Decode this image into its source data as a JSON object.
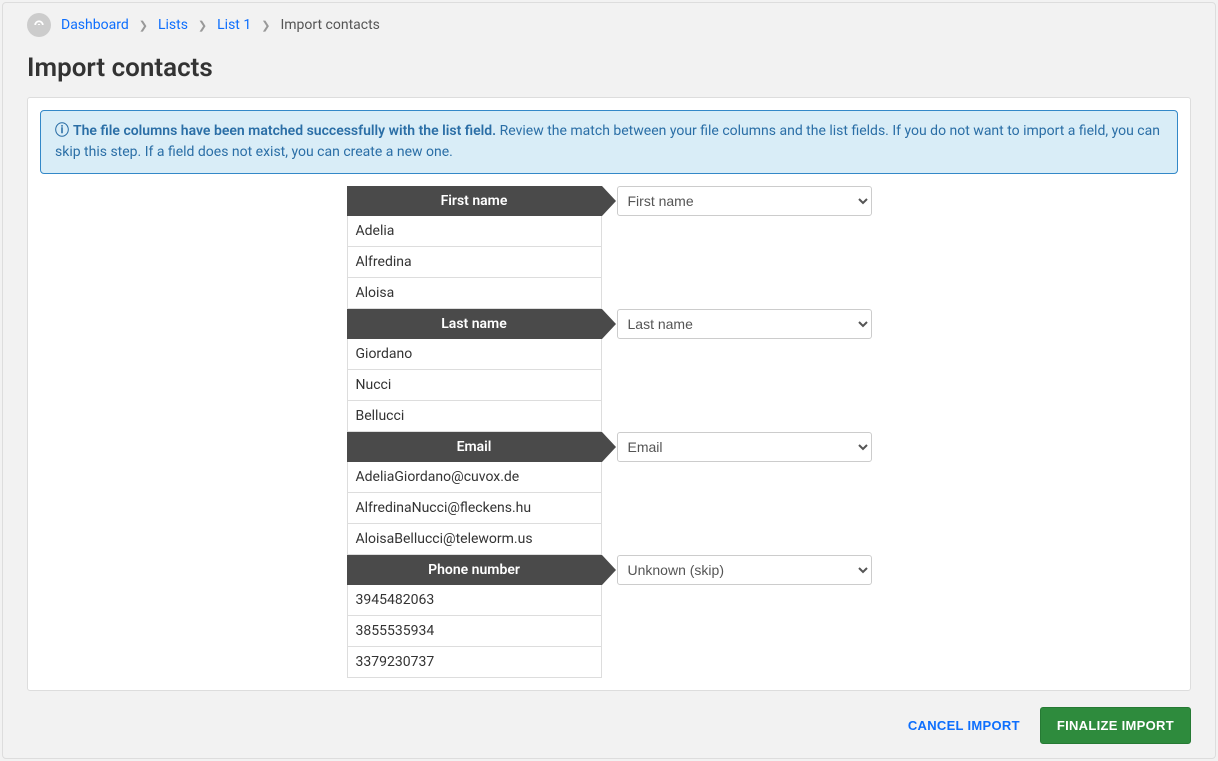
{
  "breadcrumb": {
    "items": [
      {
        "label": "Dashboard",
        "link": true
      },
      {
        "label": "Lists",
        "link": true
      },
      {
        "label": "List 1",
        "link": true
      },
      {
        "label": "Import contacts",
        "link": false
      }
    ]
  },
  "page": {
    "title": "Import contacts"
  },
  "alert": {
    "strong": "The file columns have been matched successfully with the list field.",
    "text": "Review the match between your file columns and the list fields. If you do not want to import a field, you can skip this step. If a field does not exist, you can create a new one."
  },
  "columns": [
    {
      "header": "First name",
      "rows": [
        "Adelia",
        "Alfredina",
        "Aloisa"
      ],
      "selected": "First name"
    },
    {
      "header": "Last name",
      "rows": [
        "Giordano",
        "Nucci",
        "Bellucci"
      ],
      "selected": "Last name"
    },
    {
      "header": "Email",
      "rows": [
        "AdeliaGiordano@cuvox.de",
        "AlfredinaNucci@fleckens.hu",
        "AloisaBellucci@teleworm.us"
      ],
      "selected": "Email"
    },
    {
      "header": "Phone number",
      "rows": [
        "3945482063",
        "3855535934",
        "3379230737"
      ],
      "selected": "Unknown (skip)"
    }
  ],
  "select_options": [
    "First name",
    "Last name",
    "Email",
    "Unknown (skip)"
  ],
  "footer": {
    "cancel": "CANCEL IMPORT",
    "finalize": "FINALIZE IMPORT"
  }
}
